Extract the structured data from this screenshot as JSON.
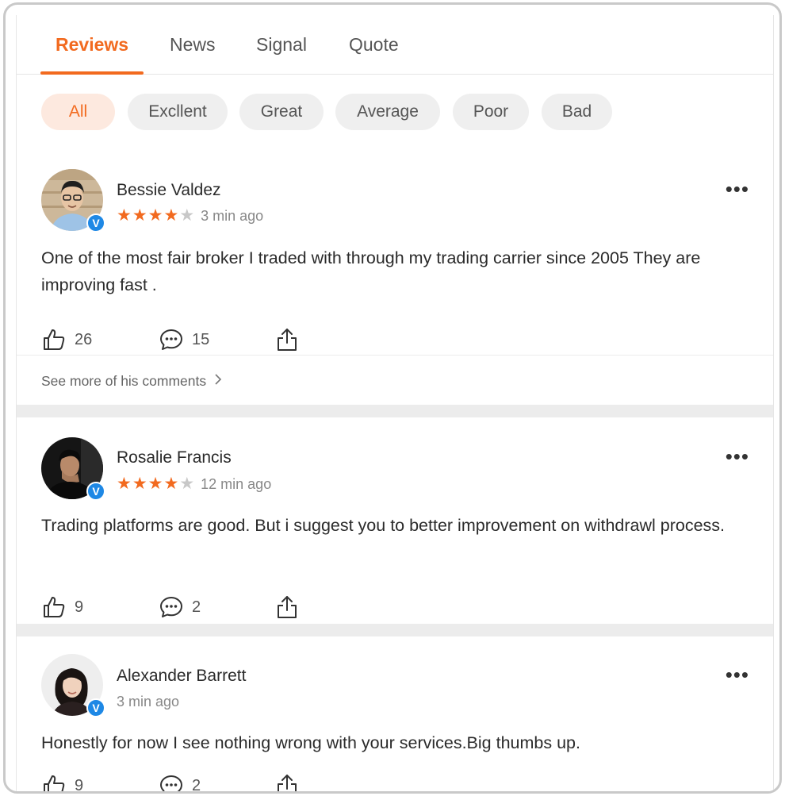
{
  "tabs": [
    {
      "label": "Reviews",
      "active": true
    },
    {
      "label": "News",
      "active": false
    },
    {
      "label": "Signal",
      "active": false
    },
    {
      "label": "Quote",
      "active": false
    }
  ],
  "filters": [
    {
      "label": "All",
      "active": true
    },
    {
      "label": "Excllent",
      "active": false
    },
    {
      "label": "Great",
      "active": false
    },
    {
      "label": "Average",
      "active": false
    },
    {
      "label": "Poor",
      "active": false
    },
    {
      "label": "Bad",
      "active": false
    }
  ],
  "colors": {
    "accent": "#f26a1f",
    "verified": "#1e88e5"
  },
  "more_icon_label": "•••",
  "badge_label": "V",
  "reviews": [
    {
      "name": "Bessie Valdez",
      "rating": 4,
      "time": "3 min ago",
      "text": "One of the most fair broker I traded with through my trading carrier since 2005 They are improving fast .",
      "likes": "26",
      "comments": "15",
      "see_more": "See more of his comments"
    },
    {
      "name": "Rosalie Francis",
      "rating": 4,
      "time": "12 min ago",
      "text": "Trading platforms are good. But i suggest you to better improvement on withdrawl process.",
      "likes": "9",
      "comments": "2"
    },
    {
      "name": "Alexander Barrett",
      "time": "3 min ago",
      "text": "Honestly for now I see nothing wrong with your services.Big thumbs up.",
      "likes": "9",
      "comments": "2"
    }
  ]
}
